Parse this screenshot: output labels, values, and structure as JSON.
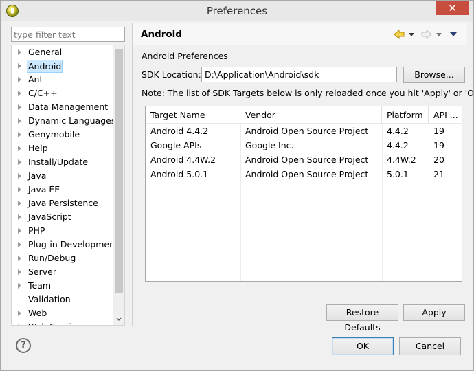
{
  "window": {
    "title": "Preferences",
    "close_glyph": "✕"
  },
  "filter": {
    "placeholder": "type filter text",
    "value": ""
  },
  "tree": {
    "items": [
      {
        "label": "General",
        "expandable": true,
        "selected": false
      },
      {
        "label": "Android",
        "expandable": true,
        "selected": true
      },
      {
        "label": "Ant",
        "expandable": true,
        "selected": false
      },
      {
        "label": "C/C++",
        "expandable": true,
        "selected": false
      },
      {
        "label": "Data Management",
        "expandable": true,
        "selected": false
      },
      {
        "label": "Dynamic Languages",
        "expandable": true,
        "selected": false
      },
      {
        "label": "Genymobile",
        "expandable": true,
        "selected": false
      },
      {
        "label": "Help",
        "expandable": true,
        "selected": false
      },
      {
        "label": "Install/Update",
        "expandable": true,
        "selected": false
      },
      {
        "label": "Java",
        "expandable": true,
        "selected": false
      },
      {
        "label": "Java EE",
        "expandable": true,
        "selected": false
      },
      {
        "label": "Java Persistence",
        "expandable": true,
        "selected": false
      },
      {
        "label": "JavaScript",
        "expandable": true,
        "selected": false
      },
      {
        "label": "PHP",
        "expandable": true,
        "selected": false
      },
      {
        "label": "Plug-in Development",
        "expandable": true,
        "selected": false
      },
      {
        "label": "Run/Debug",
        "expandable": true,
        "selected": false
      },
      {
        "label": "Server",
        "expandable": true,
        "selected": false
      },
      {
        "label": "Team",
        "expandable": true,
        "selected": false
      },
      {
        "label": "Validation",
        "expandable": false,
        "selected": false
      },
      {
        "label": "Web",
        "expandable": true,
        "selected": false
      },
      {
        "label": "Web Services",
        "expandable": true,
        "selected": false
      }
    ]
  },
  "panel": {
    "title": "Android",
    "heading": "Android Preferences",
    "sdk_label": "SDK Location:",
    "sdk_value": "D:\\Application\\Android\\sdk",
    "browse_label": "Browse...",
    "note": "Note: The list of SDK Targets below is only reloaded once you hit 'Apply' or 'OK'.",
    "nav_icons": [
      "back-arrow-icon",
      "back-menu-icon",
      "forward-arrow-icon",
      "forward-menu-icon",
      "view-menu-icon"
    ]
  },
  "targets": {
    "columns": [
      "Target Name",
      "Vendor",
      "Platform",
      "API ..."
    ],
    "rows": [
      [
        "Android 4.4.2",
        "Android Open Source Project",
        "4.4.2",
        "19"
      ],
      [
        "Google APIs",
        "Google Inc.",
        "4.4.2",
        "19"
      ],
      [
        "Android 4.4W.2",
        "Android Open Source Project",
        "4.4W.2",
        "20"
      ],
      [
        "Android 5.0.1",
        "Android Open Source Project",
        "5.0.1",
        "21"
      ]
    ]
  },
  "buttons": {
    "restore_defaults": "Restore Defaults",
    "apply": "Apply",
    "ok": "OK",
    "cancel": "Cancel",
    "help": "?"
  },
  "colors": {
    "close_button": "#c74d3e",
    "selection": "#cce8ff",
    "nav_arrow": "#e0b200"
  }
}
